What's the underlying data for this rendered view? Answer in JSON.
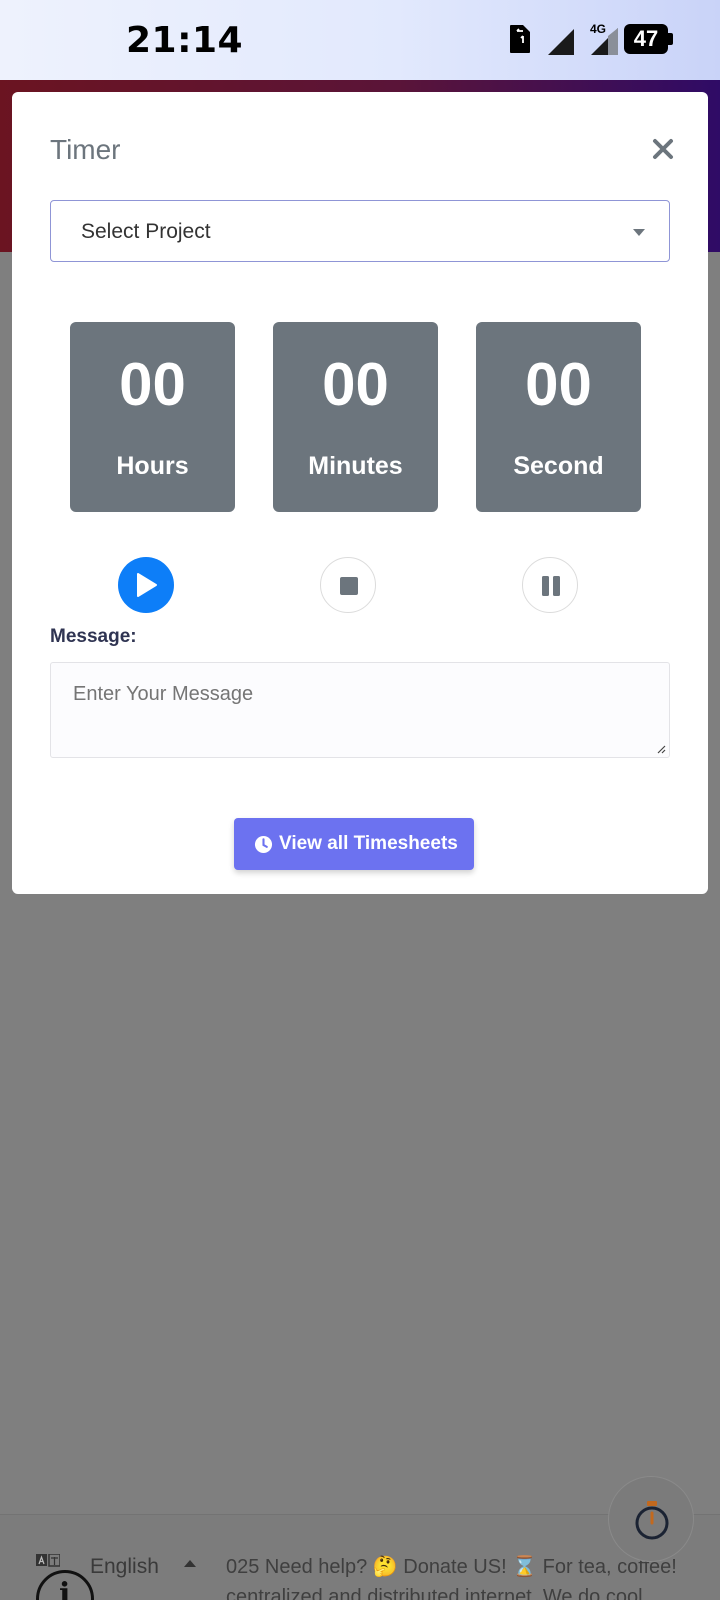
{
  "status_bar": {
    "time": "21:14",
    "network": "4G",
    "battery": "47",
    "icons": [
      "sim-card-icon",
      "signal-icon",
      "signal-4g-icon",
      "battery-icon"
    ]
  },
  "modal": {
    "title": "Timer",
    "close_icon": "close-icon",
    "project_select": {
      "selected": "Select Project"
    },
    "timer": {
      "hours": {
        "value": "00",
        "label": "Hours"
      },
      "minutes": {
        "value": "00",
        "label": "Minutes"
      },
      "seconds": {
        "value": "00",
        "label": "Second"
      }
    },
    "controls": [
      "play-icon",
      "stop-icon",
      "pause-icon"
    ],
    "message": {
      "label": "Message:",
      "placeholder": "Enter Your Message",
      "value": ""
    },
    "timesheets_button": "View all Timesheets"
  },
  "footer": {
    "language": "English",
    "marquee_line1": "025 Need help? 🤔 Donate US! ⌛ For tea, coffee!",
    "marquee_line2": "centralized and distributed internet. We do cool"
  },
  "colors": {
    "primary": "#0d7ef8",
    "timer_box": "#6c757d",
    "button": "#6c72f0",
    "overlay": "#808080"
  }
}
